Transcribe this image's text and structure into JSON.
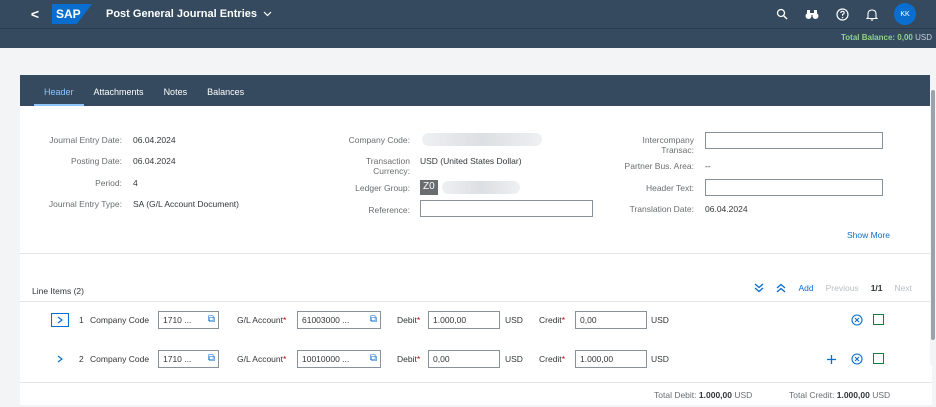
{
  "shell": {
    "back": "<",
    "logo": "SAP",
    "title": "Post General Journal Entries",
    "icons": [
      "search-icon",
      "binoculars-icon",
      "help-icon",
      "bell-icon"
    ],
    "avatar": "KK"
  },
  "subbar": {
    "balance_label": "Total Balance: 0,00",
    "balance_currency": "USD"
  },
  "tabs": [
    {
      "label": "Header"
    },
    {
      "label": "Attachments"
    },
    {
      "label": "Notes"
    },
    {
      "label": "Balances"
    }
  ],
  "header": {
    "journal_entry_date_label": "Journal Entry Date:",
    "journal_entry_date": "06.04.2024",
    "posting_date_label": "Posting Date:",
    "posting_date": "06.04.2024",
    "period_label": "Period:",
    "period": "4",
    "journal_entry_type_label": "Journal Entry Type:",
    "journal_entry_type": "SA (G/L Account Document)",
    "company_code_label": "Company Code:",
    "transaction_currency_label": "Transaction Currency:",
    "transaction_currency": "USD (United States Dollar)",
    "ledger_group_label": "Ledger Group:",
    "ledger_group_value": "Z0",
    "reference_label": "Reference:",
    "reference_value": "",
    "intercompany_label": "Intercompany Transac:",
    "intercompany_value": "",
    "partner_bus_area_label": "Partner Bus. Area:",
    "partner_bus_area": "--",
    "header_text_label": "Header Text:",
    "header_text_value": "",
    "translation_date_label": "Translation Date:",
    "translation_date": "06.04.2024",
    "show_more": "Show More"
  },
  "line_items": {
    "title": "Line Items (2)",
    "add": "Add",
    "previous": "Previous",
    "page": "1/1",
    "next": "Next",
    "company_code_label": "Company Code",
    "gl_account_label": "G/L Account",
    "debit_label": "Debit",
    "credit_label": "Credit",
    "rows": [
      {
        "index": "1",
        "company_code": "1710 ...",
        "gl_account": "61003000 ...",
        "debit": "1.000,00",
        "debit_currency": "USD",
        "credit": "0,00",
        "credit_currency": "USD"
      },
      {
        "index": "2",
        "company_code": "1710 ...",
        "gl_account": "10010000 ...",
        "debit": "0,00",
        "debit_currency": "USD",
        "credit": "1.000,00",
        "credit_currency": "USD"
      }
    ],
    "total_debit_label": "Total Debit:",
    "total_debit": "1.000,00",
    "total_debit_currency": "USD",
    "total_credit_label": "Total Credit:",
    "total_credit": "1.000,00",
    "total_credit_currency": "USD"
  }
}
